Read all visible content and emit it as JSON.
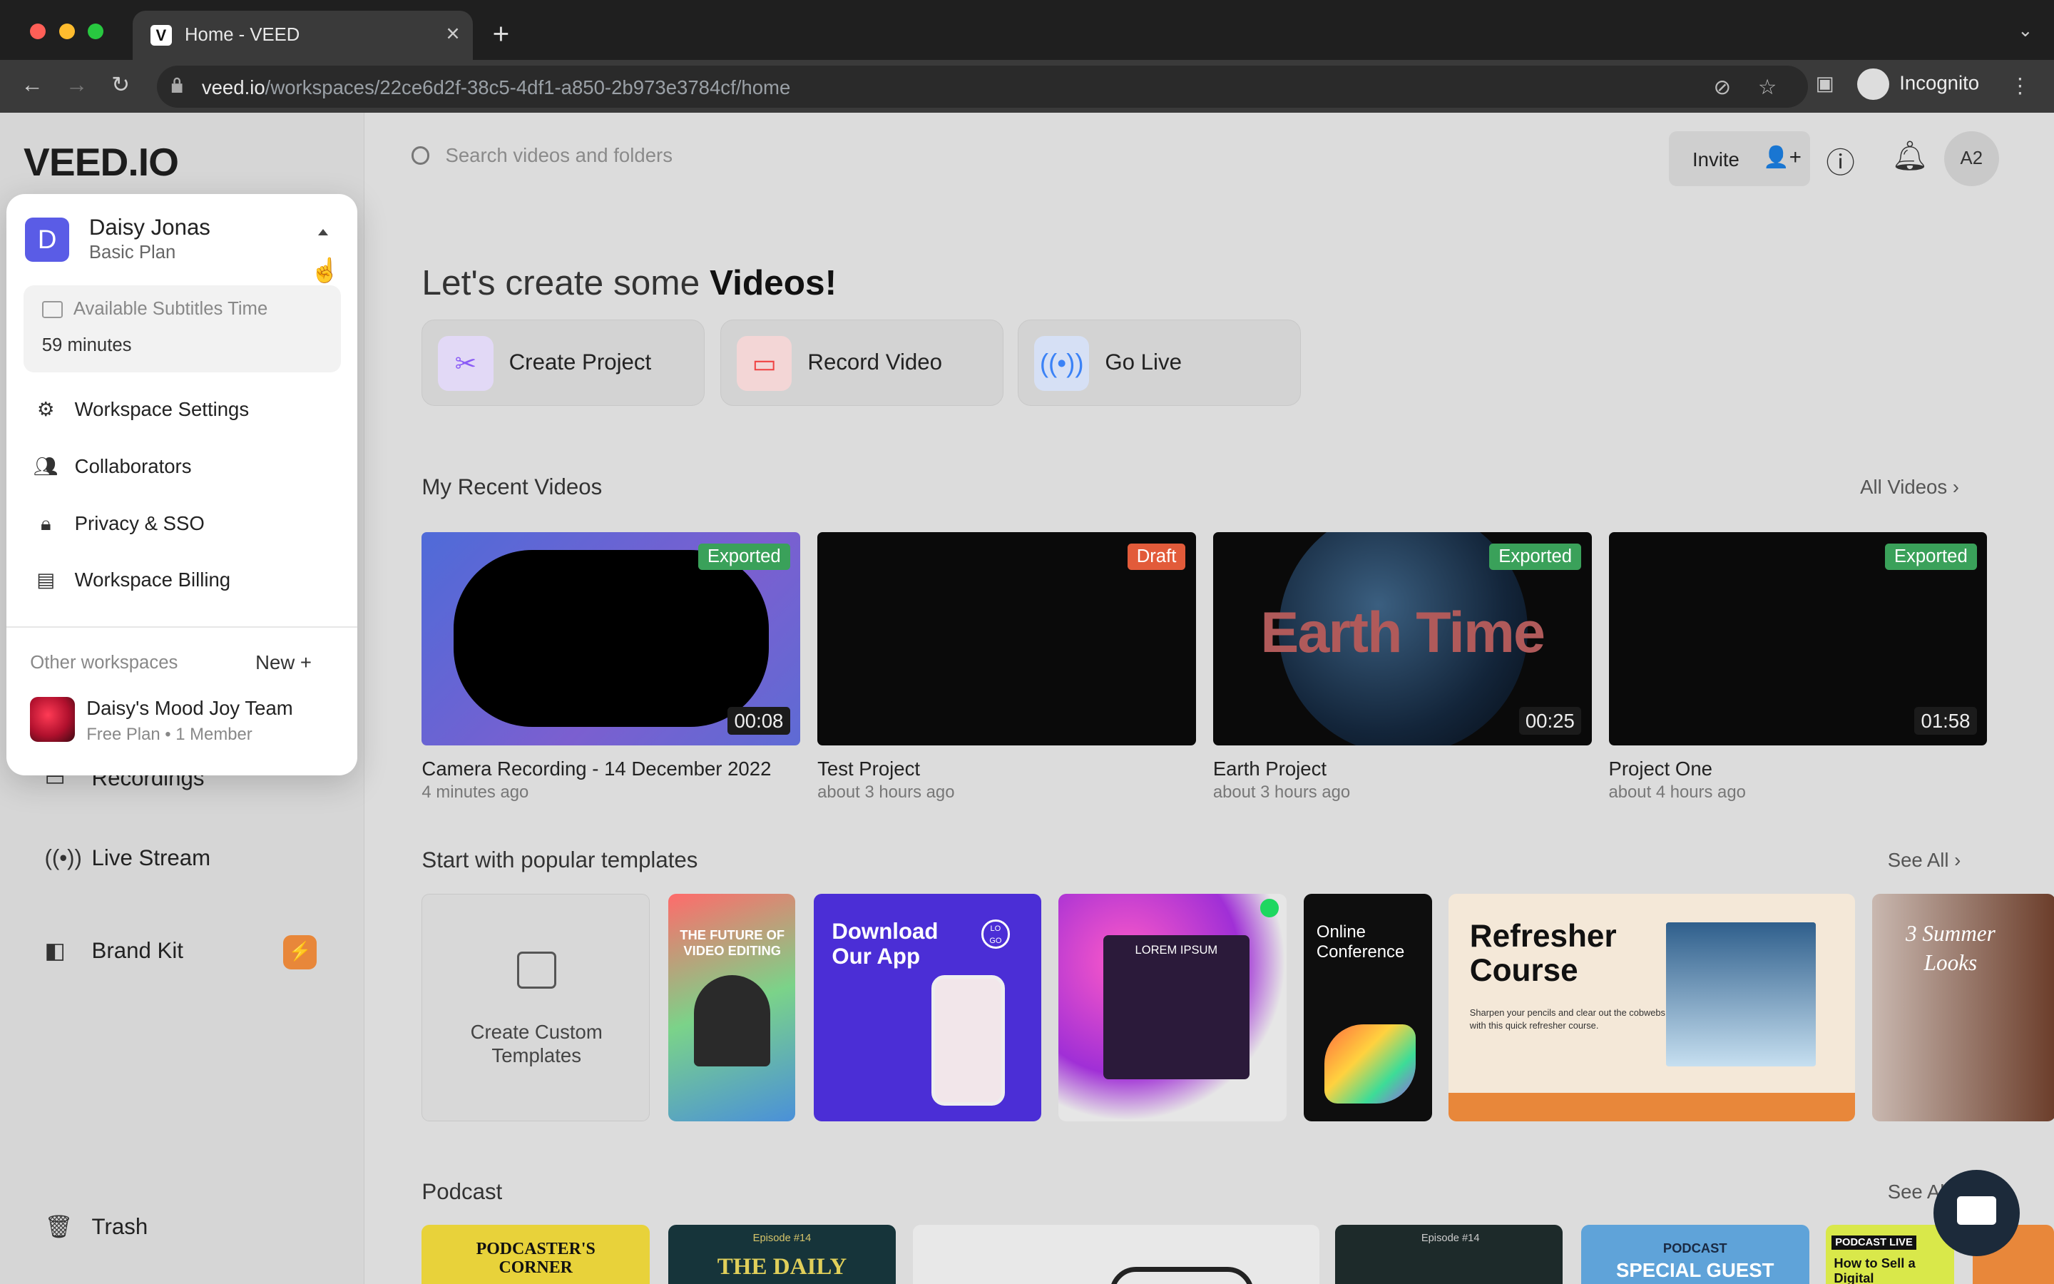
{
  "browser": {
    "tab_title": "Home - VEED",
    "url_domain": "veed.io",
    "url_path": "/workspaces/22ce6d2f-38c5-4df1-a850-2b973e3784cf/home",
    "profile_label": "Incognito"
  },
  "app": {
    "logo": "VEED.IO",
    "search_placeholder": "Search videos and folders",
    "invite_label": "Invite",
    "avatar_initials": "A2"
  },
  "sidebar": {
    "items": [
      {
        "label": "Recordings"
      },
      {
        "label": "Live Stream"
      },
      {
        "label": "Brand Kit"
      },
      {
        "label": "Trash"
      }
    ]
  },
  "dropdown": {
    "initial": "D",
    "user_name": "Daisy Jonas",
    "plan": "Basic Plan",
    "subtitles_title": "Available Subtitles Time",
    "subtitles_value": "59 minutes",
    "menu": [
      {
        "label": "Workspace Settings",
        "icon": "gear-icon"
      },
      {
        "label": "Collaborators",
        "icon": "users-icon"
      },
      {
        "label": "Privacy & SSO",
        "icon": "lock-icon"
      },
      {
        "label": "Workspace Billing",
        "icon": "billing-icon"
      }
    ],
    "other_workspaces_label": "Other workspaces",
    "new_label": "New",
    "workspace_name": "Daisy's Mood Joy Team",
    "workspace_plan": "Free Plan",
    "workspace_members": "1 Member"
  },
  "main": {
    "headline_prefix": "Let's create some ",
    "headline_bold": "Videos!",
    "actions": [
      {
        "label": "Create Project",
        "icon": "scissors-icon",
        "color": "#8b5cf6"
      },
      {
        "label": "Record Video",
        "icon": "camera-icon",
        "color": "#ef4444"
      },
      {
        "label": "Go Live",
        "icon": "broadcast-icon",
        "color": "#3b82f6"
      }
    ],
    "recent_title": "My Recent Videos",
    "all_videos_label": "All Videos",
    "videos": [
      {
        "name": "Camera Recording - 14 December 2022",
        "time": "4 minutes ago",
        "status": "Exported",
        "duration": "00:08"
      },
      {
        "name": "Test Project",
        "time": "about 3 hours ago",
        "status": "Draft",
        "duration": ""
      },
      {
        "name": "Earth Project",
        "time": "about 3 hours ago",
        "status": "Exported",
        "duration": "00:25"
      },
      {
        "name": "Project One",
        "time": "about 4 hours ago",
        "status": "Exported",
        "duration": "01:58"
      }
    ],
    "earth_title_text": "Earth Time",
    "templates_title": "Start with popular templates",
    "see_all_label": "See All",
    "custom_templates_label": "Create Custom Templates",
    "template_texts": {
      "t1": "THE FUTURE OF VIDEO EDITING",
      "t2": "Download Our App",
      "t2_logo": "LO GO",
      "t3": "LOREM IPSUM",
      "t4": "Online Conference",
      "t5": "Refresher Course",
      "t5_sub": "Sharpen your pencils and clear out the cobwebs with this quick refresher course.",
      "t6": "3 Summer Looks"
    },
    "podcast_title": "Podcast",
    "podcast_see_all": "See All",
    "podcast_texts": {
      "p1": "PODCASTER'S CORNER",
      "p2_ep": "Episode #14",
      "p2": "THE DAILY",
      "p4_ep": "Episode #14",
      "p5_top": "PODCAST",
      "p5": "SPECIAL GUEST",
      "p6_top": "PODCAST LIVE",
      "p6": "How to Sell a Digital"
    }
  },
  "colors": {
    "accent": "#5a5ce6",
    "exported": "#3aa15a",
    "draft": "#e25b3a",
    "brand_kit_badge": "#e8873a"
  }
}
